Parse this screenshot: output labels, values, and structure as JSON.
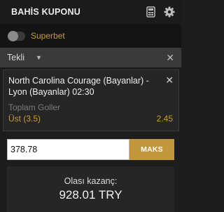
{
  "header": {
    "title": "BAHİS KUPONU",
    "icons": [
      "calculator-icon",
      "gear-icon"
    ]
  },
  "superbet": {
    "label": "Superbet",
    "enabled": false
  },
  "bet_type": {
    "selected": "Tekli"
  },
  "bet": {
    "match": "North Carolina Courage (Bayanlar) - Lyon (Bayanlar) 02:30",
    "market": "Toplam Goller",
    "selection": "Üst (3.5)",
    "odds": "2.45"
  },
  "stake": {
    "value": "378.78",
    "max_label": "MAKS"
  },
  "payout": {
    "label": "Olası kazanç:",
    "amount": "928.01 TRY"
  },
  "colors": {
    "accent": "#c99a36",
    "button": "#c2963c",
    "background": "#1d1d1d"
  }
}
